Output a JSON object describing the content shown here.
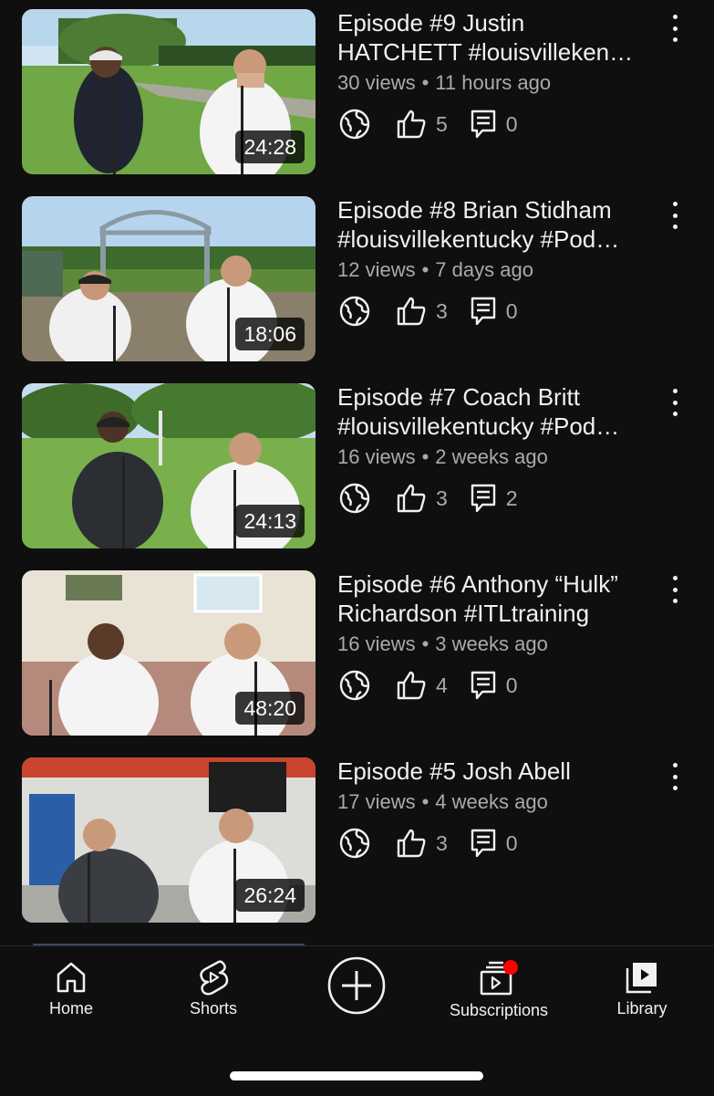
{
  "videos": [
    {
      "title": "Episode #9 Justin HATCHETT #louisvilleken…",
      "title_line1": "Episode #9 Justin",
      "title_line2": "HATCHETT #louisvilleken…",
      "views": "30 views",
      "age": "11 hours ago",
      "likes": "5",
      "comments": "0",
      "duration": "24:28"
    },
    {
      "title": "Episode #8 Brian Stidham #louisvillekentucky #Pod…",
      "title_line1": "Episode #8 Brian Stidham",
      "title_line2": "#louisvillekentucky #Pod…",
      "views": "12 views",
      "age": "7 days ago",
      "likes": "3",
      "comments": "0",
      "duration": "18:06"
    },
    {
      "title": "Episode #7 Coach Britt #louisvillekentucky #Pod…",
      "title_line1": "Episode #7 Coach Britt",
      "title_line2": "#louisvillekentucky #Pod…",
      "views": "16 views",
      "age": "2 weeks ago",
      "likes": "3",
      "comments": "2",
      "duration": "24:13"
    },
    {
      "title": "Episode #6 Anthony “Hulk” Richardson #ITLtraining",
      "title_line1": "Episode #6 Anthony “Hulk”",
      "title_line2": "Richardson #ITLtraining",
      "views": "16 views",
      "age": "3 weeks ago",
      "likes": "4",
      "comments": "0",
      "duration": "48:20"
    },
    {
      "title": "Episode #5 Josh Abell",
      "title_line1": "Episode #5 Josh Abell",
      "title_line2": "",
      "views": "17 views",
      "age": "4 weeks ago",
      "likes": "3",
      "comments": "0",
      "duration": "26:24"
    }
  ],
  "meta_separator": "•",
  "icons": {
    "visibility": "globe-icon",
    "like": "thumbs-up-icon",
    "comments": "comment-icon",
    "menu": "more-vert-icon"
  },
  "bottom_nav": {
    "home": {
      "label": "Home",
      "icon": "home-icon"
    },
    "shorts": {
      "label": "Shorts",
      "icon": "shorts-icon"
    },
    "create": {
      "icon": "plus-circle-icon"
    },
    "subscriptions": {
      "label": "Subscriptions",
      "icon": "subscriptions-icon",
      "has_notification": true
    },
    "library": {
      "label": "Library",
      "icon": "library-icon"
    }
  },
  "colors": {
    "background": "#0f0f0f",
    "text_primary": "#f1f1f1",
    "text_secondary": "#aaaaaa",
    "notification_dot": "#ff0000"
  }
}
